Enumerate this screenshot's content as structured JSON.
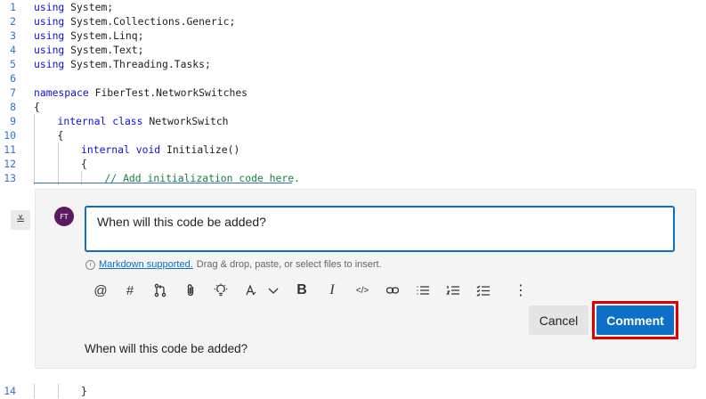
{
  "code_lines_top": [
    {
      "num": "1",
      "indent": 0,
      "parts": [
        {
          "t": "using",
          "c": "kw"
        },
        {
          "t": " System;"
        }
      ]
    },
    {
      "num": "2",
      "indent": 0,
      "parts": [
        {
          "t": "using",
          "c": "kw"
        },
        {
          "t": " System.Collections.Generic;"
        }
      ]
    },
    {
      "num": "3",
      "indent": 0,
      "parts": [
        {
          "t": "using",
          "c": "kw"
        },
        {
          "t": " System.Linq;"
        }
      ]
    },
    {
      "num": "4",
      "indent": 0,
      "parts": [
        {
          "t": "using",
          "c": "kw"
        },
        {
          "t": " System.Text;"
        }
      ]
    },
    {
      "num": "5",
      "indent": 0,
      "parts": [
        {
          "t": "using",
          "c": "kw"
        },
        {
          "t": " System.Threading.Tasks;"
        }
      ]
    },
    {
      "num": "6",
      "indent": 0,
      "parts": []
    },
    {
      "num": "7",
      "indent": 0,
      "parts": [
        {
          "t": "namespace",
          "c": "kw"
        },
        {
          "t": " FiberTest.NetworkSwitches"
        }
      ]
    },
    {
      "num": "8",
      "indent": 0,
      "parts": [
        {
          "t": "{"
        }
      ]
    },
    {
      "num": "9",
      "indent": 1,
      "parts": [
        {
          "t": "internal",
          "c": "kw"
        },
        {
          "t": " "
        },
        {
          "t": "class",
          "c": "kw"
        },
        {
          "t": " NetworkSwitch"
        }
      ]
    },
    {
      "num": "10",
      "indent": 1,
      "parts": [
        {
          "t": "{"
        }
      ]
    },
    {
      "num": "11",
      "indent": 2,
      "parts": [
        {
          "t": "internal",
          "c": "kw"
        },
        {
          "t": " "
        },
        {
          "t": "void",
          "c": "kw"
        },
        {
          "t": " Initialize()"
        }
      ]
    },
    {
      "num": "12",
      "indent": 2,
      "parts": [
        {
          "t": "{"
        }
      ]
    },
    {
      "num": "13",
      "indent": 3,
      "parts": [
        {
          "t": "// Add initialization code here.",
          "c": "cm"
        }
      ]
    }
  ],
  "code_line_bottom": {
    "num": "14",
    "indent": 2,
    "parts": [
      {
        "t": "}"
      }
    ]
  },
  "thread": {
    "avatar_initials": "FT",
    "input_value": "When will this code be added?",
    "markdown_link": "Markdown supported.",
    "markdown_hint": "Drag & drop, paste, or select files to insert.",
    "info_glyph": "i",
    "collapse_glyph": "≚",
    "cancel_label": "Cancel",
    "comment_label": "Comment",
    "preview_text": "When will this code be added?"
  },
  "toolbar": [
    {
      "name": "mention-icon",
      "label": "@"
    },
    {
      "name": "work-item-icon",
      "label": "#"
    },
    {
      "name": "pull-request-icon",
      "label": ""
    },
    {
      "name": "attach-icon",
      "label": ""
    },
    {
      "name": "suggestion-icon",
      "label": ""
    },
    {
      "name": "heading-icon",
      "label": ""
    },
    {
      "name": "heading-dropdown-icon",
      "label": ""
    },
    {
      "name": "bold-icon",
      "label": "B"
    },
    {
      "name": "italic-icon",
      "label": "I"
    },
    {
      "name": "code-icon",
      "label": "</>"
    },
    {
      "name": "link-icon",
      "label": ""
    },
    {
      "name": "bulleted-list-icon",
      "label": ""
    },
    {
      "name": "numbered-list-icon",
      "label": ""
    },
    {
      "name": "checklist-icon",
      "label": ""
    },
    {
      "name": "more-options-icon",
      "label": "⋮"
    }
  ],
  "colors": {
    "accent": "#0e6fc7",
    "highlight": "#e00000",
    "keyword": "#1010d8",
    "comment": "#1a7f37"
  }
}
